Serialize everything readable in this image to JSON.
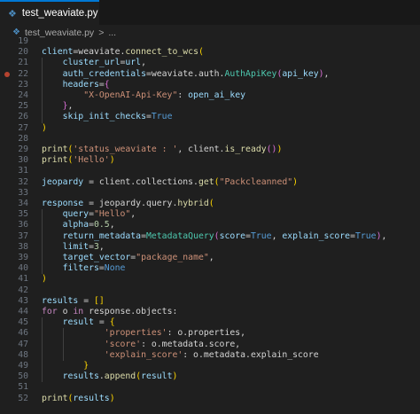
{
  "tab": {
    "filename": "test_weaviate.py",
    "icon": "python-file-icon"
  },
  "breadcrumb": {
    "filename": "test_weaviate.py",
    "separator": ">",
    "more": "..."
  },
  "lines": [
    {
      "n": "19",
      "tokens": []
    },
    {
      "n": "20",
      "tokens": [
        [
          "v",
          "client"
        ],
        [
          "",
          "="
        ],
        [
          "",
          "weaviate."
        ],
        [
          "fn",
          "connect_to_wcs"
        ],
        [
          "p1",
          "("
        ]
      ]
    },
    {
      "n": "21",
      "tokens": [
        [
          "",
          "    "
        ],
        [
          "v",
          "cluster_url"
        ],
        [
          "",
          "="
        ],
        [
          "v",
          "url"
        ],
        [
          "",
          ","
        ]
      ]
    },
    {
      "n": "22",
      "bp": true,
      "tokens": [
        [
          "",
          "    "
        ],
        [
          "v",
          "auth_credentials"
        ],
        [
          "",
          "="
        ],
        [
          "",
          "weaviate.auth."
        ],
        [
          "t",
          "AuthApiKey"
        ],
        [
          "p2",
          "("
        ],
        [
          "v",
          "api_key"
        ],
        [
          "p2",
          ")"
        ],
        [
          "",
          ","
        ]
      ]
    },
    {
      "n": "23",
      "tokens": [
        [
          "",
          "    "
        ],
        [
          "v",
          "headers"
        ],
        [
          "",
          ""
        ],
        [
          "",
          "="
        ],
        [
          "p2",
          "{"
        ]
      ]
    },
    {
      "n": "24",
      "tokens": [
        [
          "",
          "        "
        ],
        [
          "s",
          "\"X-OpenAI-Api-Key\""
        ],
        [
          "",
          ": "
        ],
        [
          "v",
          "open_ai_key"
        ]
      ]
    },
    {
      "n": "25",
      "tokens": [
        [
          "",
          "    "
        ],
        [
          "p2",
          "}"
        ],
        [
          "",
          ","
        ]
      ]
    },
    {
      "n": "26",
      "tokens": [
        [
          "",
          "    "
        ],
        [
          "v",
          "skip_init_checks"
        ],
        [
          "",
          "="
        ],
        [
          "c",
          "True"
        ]
      ]
    },
    {
      "n": "27",
      "tokens": [
        [
          "p1",
          ")"
        ]
      ]
    },
    {
      "n": "28",
      "tokens": []
    },
    {
      "n": "29",
      "tokens": [
        [
          "fn",
          "print"
        ],
        [
          "p1",
          "("
        ],
        [
          "s",
          "'status_weaviate : '"
        ],
        [
          "",
          ", client."
        ],
        [
          "fn",
          "is_ready"
        ],
        [
          "p2",
          "()"
        ],
        [
          "p1",
          ")"
        ]
      ]
    },
    {
      "n": "30",
      "tokens": [
        [
          "fn",
          "print"
        ],
        [
          "p1",
          "("
        ],
        [
          "s",
          "'Hello'"
        ],
        [
          "p1",
          ")"
        ]
      ]
    },
    {
      "n": "31",
      "tokens": []
    },
    {
      "n": "32",
      "tokens": [
        [
          "v",
          "jeopardy"
        ],
        [
          "",
          " = client.collections."
        ],
        [
          "fn",
          "get"
        ],
        [
          "p1",
          "("
        ],
        [
          "s",
          "\"Packcleanned\""
        ],
        [
          "p1",
          ")"
        ]
      ]
    },
    {
      "n": "33",
      "tokens": []
    },
    {
      "n": "34",
      "tokens": [
        [
          "v",
          "response"
        ],
        [
          "",
          " = jeopardy.query."
        ],
        [
          "fn",
          "hybrid"
        ],
        [
          "p1",
          "("
        ]
      ]
    },
    {
      "n": "35",
      "tokens": [
        [
          "",
          "    "
        ],
        [
          "v",
          "query"
        ],
        [
          "",
          "="
        ],
        [
          "s",
          "\"Hello\""
        ],
        [
          "",
          ","
        ]
      ]
    },
    {
      "n": "36",
      "tokens": [
        [
          "",
          "    "
        ],
        [
          "v",
          "alpha"
        ],
        [
          "",
          "="
        ],
        [
          "n",
          "0.5"
        ],
        [
          "",
          ","
        ]
      ]
    },
    {
      "n": "37",
      "tokens": [
        [
          "",
          "    "
        ],
        [
          "v",
          "return_metadata"
        ],
        [
          "",
          "="
        ],
        [
          "t",
          "MetadataQuery"
        ],
        [
          "p2",
          "("
        ],
        [
          "v",
          "score"
        ],
        [
          "",
          "="
        ],
        [
          "c",
          "True"
        ],
        [
          "",
          ", "
        ],
        [
          "v",
          "explain_score"
        ],
        [
          "",
          "="
        ],
        [
          "c",
          "True"
        ],
        [
          "p2",
          ")"
        ],
        [
          "",
          ","
        ]
      ]
    },
    {
      "n": "38",
      "tokens": [
        [
          "",
          "    "
        ],
        [
          "v",
          "limit"
        ],
        [
          "",
          "="
        ],
        [
          "n",
          "3"
        ],
        [
          "",
          ","
        ]
      ]
    },
    {
      "n": "39",
      "tokens": [
        [
          "",
          "    "
        ],
        [
          "v",
          "target_vector"
        ],
        [
          "",
          "="
        ],
        [
          "s",
          "\"package_name\""
        ],
        [
          "",
          ","
        ]
      ]
    },
    {
      "n": "40",
      "tokens": [
        [
          "",
          "    "
        ],
        [
          "v",
          "filters"
        ],
        [
          "",
          "="
        ],
        [
          "c",
          "None"
        ]
      ]
    },
    {
      "n": "41",
      "tokens": [
        [
          "p1",
          ")"
        ]
      ]
    },
    {
      "n": "42",
      "tokens": []
    },
    {
      "n": "43",
      "tokens": [
        [
          "v",
          "results"
        ],
        [
          "",
          " = "
        ],
        [
          "p1",
          "[]"
        ]
      ]
    },
    {
      "n": "44",
      "tokens": [
        [
          "k",
          "for"
        ],
        [
          "",
          " o "
        ],
        [
          "k",
          "in"
        ],
        [
          "",
          " response.objects:"
        ]
      ]
    },
    {
      "n": "45",
      "tokens": [
        [
          "",
          "    "
        ],
        [
          "v",
          "result"
        ],
        [
          "",
          " = "
        ],
        [
          "p1",
          "{"
        ]
      ]
    },
    {
      "n": "46",
      "tokens": [
        [
          "",
          "            "
        ],
        [
          "s",
          "'properties'"
        ],
        [
          "",
          ": o.properties,"
        ]
      ]
    },
    {
      "n": "47",
      "tokens": [
        [
          "",
          "            "
        ],
        [
          "s",
          "'score'"
        ],
        [
          "",
          ": o.metadata.score,"
        ]
      ]
    },
    {
      "n": "48",
      "tokens": [
        [
          "",
          "            "
        ],
        [
          "s",
          "'explain_score'"
        ],
        [
          "",
          ": o.metadata.explain_score"
        ]
      ]
    },
    {
      "n": "49",
      "tokens": [
        [
          "",
          "        "
        ],
        [
          "p1",
          "}"
        ]
      ]
    },
    {
      "n": "50",
      "tokens": [
        [
          "",
          "    "
        ],
        [
          "v",
          "results"
        ],
        [
          "",
          "."
        ],
        [
          "fn",
          "append"
        ],
        [
          "p1",
          "("
        ],
        [
          "v",
          "result"
        ],
        [
          "p1",
          ")"
        ]
      ]
    },
    {
      "n": "51",
      "tokens": []
    },
    {
      "n": "52",
      "tokens": [
        [
          "fn",
          "print"
        ],
        [
          "p1",
          "("
        ],
        [
          "v",
          "results"
        ],
        [
          "p1",
          ")"
        ]
      ]
    }
  ]
}
